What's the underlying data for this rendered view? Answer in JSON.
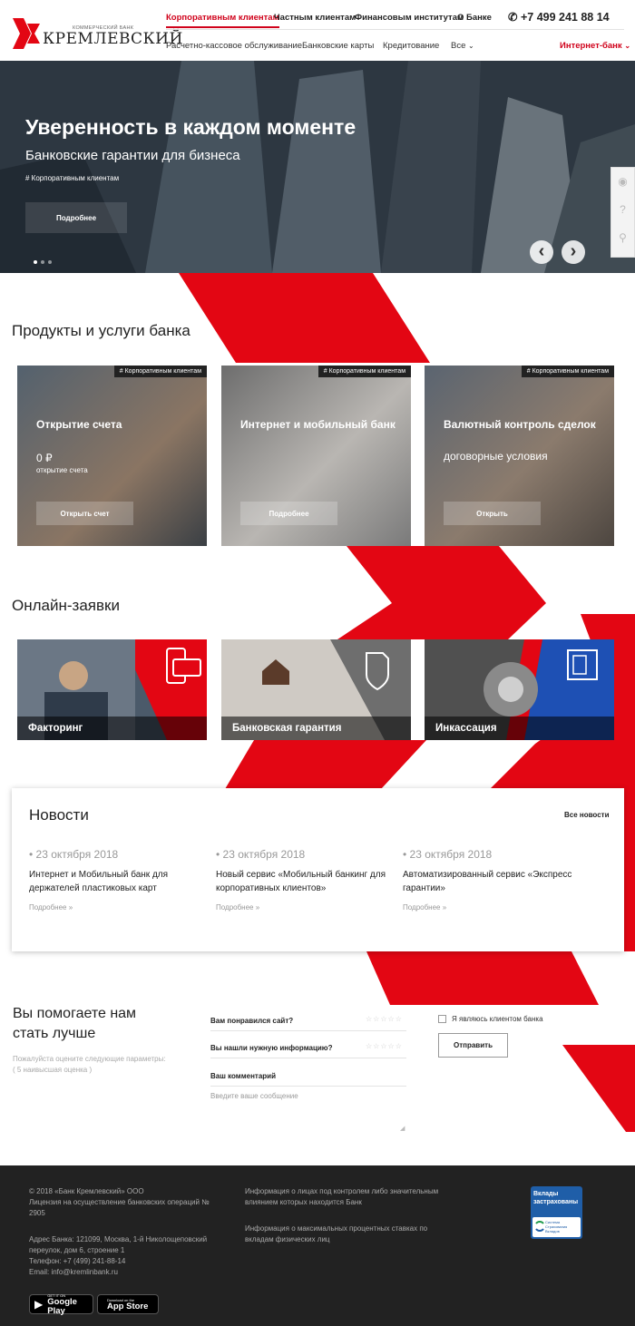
{
  "header": {
    "logo_small": "КОММЕРЧЕСКИЙ БАНК",
    "logo_big": "КРЕМЛЕВСКИЙ",
    "top_nav": [
      "Корпоративным клиентам",
      "Частным клиентам",
      "Финансовым институтам",
      "О Банке"
    ],
    "phone": "+7 499 241 88 14",
    "sub_nav": [
      "Расчетно-кассовое обслуживание",
      "Банковские карты",
      "Кредитование",
      "Все"
    ],
    "internet_bank": "Интернет-банк"
  },
  "hero": {
    "title": "Уверенность в каждом моменте",
    "subtitle": "Банковские гарантии для бизнеса",
    "tag": "# Корпоративным клиентам",
    "button": "Подробнее"
  },
  "products": {
    "heading": "Продукты и услуги банка",
    "cards": [
      {
        "tag": "# Корпоративным клиентам",
        "title": "Открытие счета",
        "value": "0 ₽",
        "note": "открытие счета",
        "button": "Открыть счет"
      },
      {
        "tag": "# Корпоративным клиентам",
        "title": "Интернет и мобильный банк",
        "value": "",
        "note": "",
        "button": "Подробнее"
      },
      {
        "tag": "# Корпоративным клиентам",
        "title": "Валютный контроль сделок",
        "value": "договорные условия",
        "note": "",
        "button": "Открыть"
      }
    ]
  },
  "online": {
    "heading": "Онлайн-заявки",
    "cards": [
      {
        "label": "Факторинг",
        "color": "#e30613"
      },
      {
        "label": "Банковская гарантия",
        "color": "#555555"
      },
      {
        "label": "Инкассация",
        "color": "#1e50b4"
      }
    ]
  },
  "news": {
    "heading": "Новости",
    "all": "Все новости",
    "items": [
      {
        "date": "23 октября 2018",
        "title": "Интернет и Мобильный банк для держателей пластиковых карт",
        "more": "Подробнее »"
      },
      {
        "date": "23 октября 2018",
        "title": "Новый сервис «Мобильный банкинг для корпоративных клиентов»",
        "more": "Подробнее »"
      },
      {
        "date": "23 октября 2018",
        "title": "Автоматизированный сервис «Экспресс гарантии»",
        "more": "Подробнее »"
      }
    ]
  },
  "feedback": {
    "heading_1": "Вы помогаете нам",
    "heading_2": "стать лучше",
    "note_1": "Пожалуйста оцените следующие параметры:",
    "note_2": "( 5 наивысшая оценка )",
    "q1": "Вам понравился сайт?",
    "q2": "Вы нашли нужную информацию?",
    "stars": "☆☆☆☆☆",
    "comment_label": "Ваш комментарий",
    "comment_placeholder": "Введите ваше сообщение",
    "client_checkbox": "Я являюсь клиентом банка",
    "send": "Отправить"
  },
  "footer": {
    "copyright": "© 2018 «Банк Кремлевский» ООО",
    "license": "Лицензия на осуществление банковских операций № 2905",
    "address": "Адрес Банка: 121099, Москва, 1-й Николощеповский переулок, дом 6, строение 1",
    "phone": "Телефон: +7 (499) 241-88-14",
    "email": "Email: info@kremlinbank.ru",
    "info_1": "Информация о лицах под контролем либо значительным влиянием которых находится Банк",
    "info_2": "Информация о максимальных процентных ставках по вкладам физических лиц",
    "google_small": "GET IT ON",
    "google_big": "Google Play",
    "apple_small": "Download on the",
    "apple_big": "App Store",
    "badge_title": "Вклады застрахованы",
    "badge_sub": "Система Страхования Вкладов"
  },
  "colors": {
    "accent": "#e30613",
    "dark": "#222222"
  }
}
